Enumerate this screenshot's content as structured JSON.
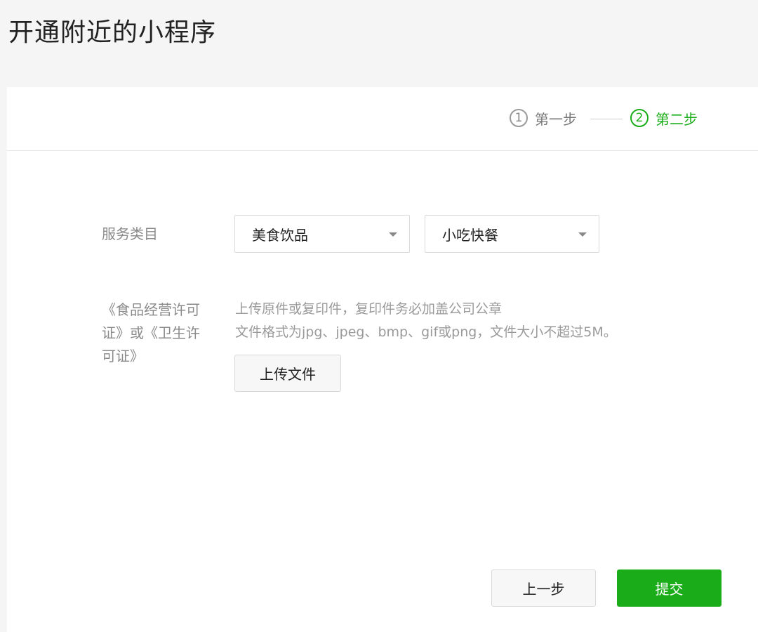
{
  "page": {
    "title": "开通附近的小程序"
  },
  "steps": [
    {
      "number": "1",
      "label": "第一步",
      "state": "done"
    },
    {
      "number": "2",
      "label": "第二步",
      "state": "active"
    }
  ],
  "form": {
    "category_label": "服务类目",
    "category_primary": "美食饮品",
    "category_secondary": "小吃快餐",
    "license_label": "《食品经营许可证》或《卫生许可证》",
    "hint_line_1": "上传原件或复印件，复印件务必加盖公司公章",
    "hint_line_2": "文件格式为jpg、jpeg、bmp、gif或png，文件大小不超过5M。",
    "upload_label": "上传文件"
  },
  "actions": {
    "prev_label": "上一步",
    "submit_label": "提交"
  },
  "colors": {
    "accent": "#1aad19",
    "muted_text": "#9a9a9a",
    "background": "#f5f5f5"
  },
  "icons": {
    "dropdown": "chevron-down-icon"
  }
}
